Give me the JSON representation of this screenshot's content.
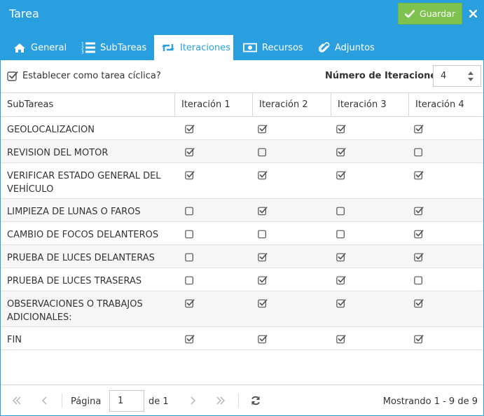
{
  "window": {
    "title": "Tarea"
  },
  "toolbar": {
    "save_label": "Guardar"
  },
  "tabs": [
    {
      "label": "General",
      "icon": "home-icon",
      "active": false
    },
    {
      "label": "SubTareas",
      "icon": "list-numbered-icon",
      "active": false
    },
    {
      "label": "Iteraciones",
      "icon": "retweet-icon",
      "active": true
    },
    {
      "label": "Recursos",
      "icon": "money-icon",
      "active": false
    },
    {
      "label": "Adjuntos",
      "icon": "paperclip-icon",
      "active": false
    }
  ],
  "options": {
    "cyclic_label": "Establecer como tarea cíclica?",
    "cyclic_checked": true,
    "iterations_label": "Número de Iteraciones:",
    "iterations_value": "4"
  },
  "grid": {
    "columns": [
      "SubTareas",
      "Iteración 1",
      "Iteración 2",
      "Iteración 3",
      "Iteración 4"
    ],
    "rows": [
      {
        "name": "GEOLOCALIZACION",
        "checks": [
          true,
          true,
          true,
          true
        ]
      },
      {
        "name": "REVISION DEL MOTOR",
        "checks": [
          true,
          false,
          true,
          false
        ]
      },
      {
        "name": "VERIFICAR ESTADO GENERAL DEL VEHÍCULO",
        "checks": [
          true,
          true,
          true,
          true
        ]
      },
      {
        "name": "LIMPIEZA DE LUNAS O FAROS",
        "checks": [
          false,
          true,
          false,
          true
        ]
      },
      {
        "name": "CAMBIO DE FOCOS DELANTEROS",
        "checks": [
          false,
          false,
          false,
          true
        ]
      },
      {
        "name": "PRUEBA DE LUCES DELANTERAS",
        "checks": [
          false,
          true,
          true,
          true
        ]
      },
      {
        "name": "PRUEBA DE LUCES TRASERAS",
        "checks": [
          false,
          true,
          true,
          false
        ]
      },
      {
        "name": "OBSERVACIONES O TRABAJOS ADICIONALES:",
        "checks": [
          true,
          true,
          true,
          true
        ]
      },
      {
        "name": "FIN",
        "checks": [
          true,
          true,
          true,
          true
        ]
      }
    ]
  },
  "pager": {
    "page_label": "Página",
    "page_value": "1",
    "of_label": "de 1",
    "showing": "Mostrando 1 - 9 de 9"
  },
  "colors": {
    "accent": "#2a9fe0",
    "save": "#7ec34f",
    "check": "#555555"
  }
}
